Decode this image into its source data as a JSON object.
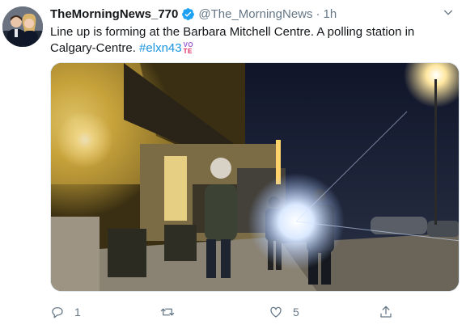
{
  "tweet": {
    "display_name": "TheMorningNews_770",
    "handle": "@The_MorningNews",
    "separator": "·",
    "time": "1h",
    "text": "Line up is forming at the Barbara Mitchell Centre. A polling station in Calgary-Centre. ",
    "hashtag": "#elxn43",
    "vote_emoji_top": "VO",
    "vote_emoji_bottom": "TE"
  },
  "actions": {
    "reply_count": "1",
    "retweet_count": "",
    "like_count": "5"
  },
  "icons": {
    "verified": "verified-badge-icon",
    "caret": "chevron-down-icon",
    "reply": "reply-icon",
    "retweet": "retweet-icon",
    "like": "heart-icon",
    "share": "share-icon"
  },
  "colors": {
    "name": "#14171a",
    "muted": "#657786",
    "link": "#1b95e0",
    "verified": "#1da1f2"
  }
}
